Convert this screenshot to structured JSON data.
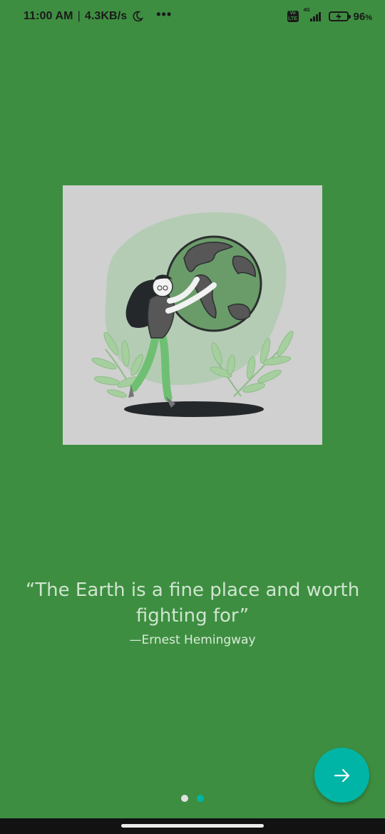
{
  "status_bar": {
    "time": "11:00 AM",
    "separator": "|",
    "network_speed": "4.3KB/s",
    "more_indicator": "•••",
    "volte_label": "Vo LTE",
    "network_type": "4G",
    "battery_percent": "96",
    "battery_unit": "%",
    "icons": [
      "moon-icon",
      "volte-icon",
      "signal-icon",
      "battery-charging-icon"
    ]
  },
  "onboarding": {
    "illustration_icon": "woman-hugging-earth-illustration",
    "quote": "“The Earth is a fine place and worth fighting for”",
    "author": "—Ernest Hemingway",
    "pagination": {
      "total": 2,
      "active_index": 2
    },
    "next_button_icon": "arrow-right-icon"
  },
  "colors": {
    "background": "#3e8e41",
    "accent": "#00b5a5",
    "dot_inactive": "#e0e0e0",
    "dot_active": "#00b5a5"
  }
}
